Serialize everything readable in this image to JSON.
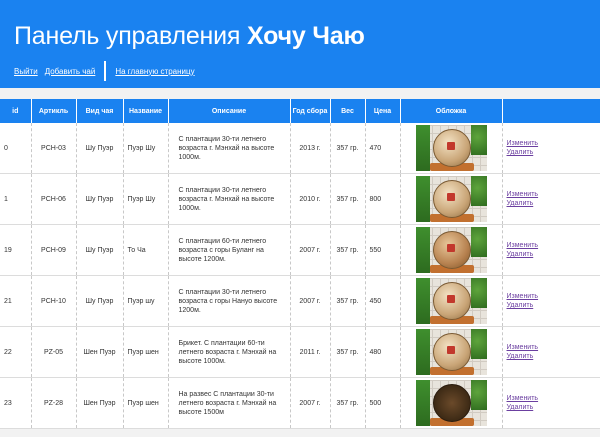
{
  "header": {
    "title_prefix": "Панель управления",
    "title_brand": "Хочу Чаю",
    "nav": {
      "logout": "Выйти",
      "add_tea": "Добавить чай",
      "home": "На главную страницу"
    }
  },
  "table": {
    "columns": [
      "id",
      "Артикль",
      "Вид чая",
      "Название",
      "Описание",
      "Год сбора",
      "Вес",
      "Цена",
      "Обложка",
      ""
    ],
    "edit_label": "Изменить",
    "delete_label": "Удалить",
    "rows": [
      {
        "id": "0",
        "sku": "PCH-03",
        "kind": "Шу Пуэр",
        "name": "Пуэр Шу",
        "description": "С плантации 30-ти летнего возраста г. Мэнхай на высоте 1000м.",
        "year": "2013 г.",
        "weight": "357 гр.",
        "price": "470",
        "cover_icon": "tea-cake-image"
      },
      {
        "id": "1",
        "sku": "PCH-06",
        "kind": "Шу Пуэр",
        "name": "Пуэр Шу",
        "description": "С плантации 30-ти летнего возраста г. Мэнхай на высоте 1000м.",
        "year": "2010 г.",
        "weight": "357 гр.",
        "price": "800",
        "cover_icon": "tea-cake-image"
      },
      {
        "id": "19",
        "sku": "PCH-09",
        "kind": "Шу Пуэр",
        "name": "То Ча",
        "description": "С плантации 60-ти летнего возраста с горы Буланг на высоте 1200м.",
        "year": "2007 г.",
        "weight": "357 гр.",
        "price": "550",
        "cover_icon": "tea-cake-image"
      },
      {
        "id": "21",
        "sku": "PCH-10",
        "kind": "Шу Пуэр",
        "name": "Пуэр шу",
        "description": "С плантации 30-ти летнего возраста с горы Нануо высоте 1200м.",
        "year": "2007 г.",
        "weight": "357 гр.",
        "price": "450",
        "cover_icon": "tea-cake-image"
      },
      {
        "id": "22",
        "sku": "PZ-05",
        "kind": "Шен Пуэр",
        "name": "Пуэр шен",
        "description": "Брикет. С плантации 60-ти летнего возраста г. Мэнхай на высоте 1000м.",
        "year": "2011 г.",
        "weight": "357 гр.",
        "price": "480",
        "cover_icon": "tea-cake-image"
      },
      {
        "id": "23",
        "sku": "PZ-28",
        "kind": "Шен Пуэр",
        "name": "Пуэр шен",
        "description": "На развес С плантации 30-ти летнего возраста г. Мэнхай на высоте 1500м",
        "year": "2007 г.",
        "weight": "357 гр.",
        "price": "500",
        "cover_icon": "loose-tea-image"
      }
    ]
  },
  "colors": {
    "accent": "#1a82f0",
    "link": "#6b3fa0"
  }
}
